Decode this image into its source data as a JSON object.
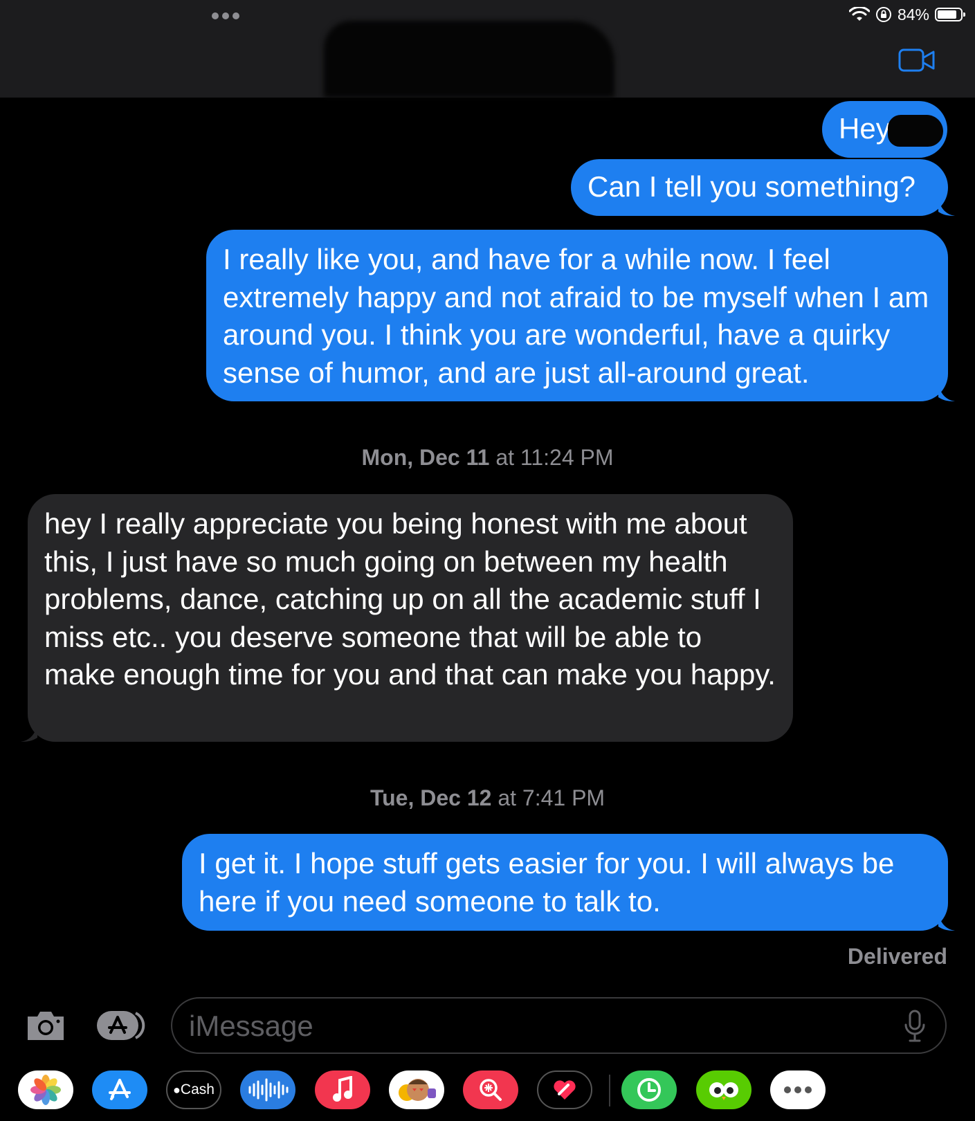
{
  "status_bar": {
    "battery_percent": "84%",
    "battery_level": 0.84
  },
  "messages": {
    "m1": "Hey",
    "m2": "Can I tell you something?",
    "m3": "I really like you, and have for a while now. I feel extremely happy and not afraid to be myself when I am around you. I think you are wonderful, have a quirky sense of humor, and are just all-around great.",
    "ts1_day": "Mon, Dec 11",
    "ts1_time": " at 11:24 PM",
    "m4": "hey I really appreciate you being honest with me about this, I just have so much going on between my health problems, dance, catching up on all the academic stuff I miss etc.. you deserve someone that will be able to make enough time for you and that can make you happy.",
    "ts2_day": "Tue, Dec 12",
    "ts2_time": " at 7:41 PM",
    "m5": "I get it. I hope stuff gets easier for you. I will always be here if you need someone to talk to.",
    "delivered": "Delivered"
  },
  "compose": {
    "placeholder": "iMessage"
  },
  "app_tray": [
    {
      "name": "photos-app-icon"
    },
    {
      "name": "app-store-app-icon"
    },
    {
      "name": "apple-cash-app-icon",
      "label": "Cash"
    },
    {
      "name": "audio-message-app-icon"
    },
    {
      "name": "music-app-icon"
    },
    {
      "name": "memoji-app-icon"
    },
    {
      "name": "images-search-app-icon"
    },
    {
      "name": "digital-touch-app-icon"
    },
    {
      "name": "clock-app-icon"
    },
    {
      "name": "duolingo-app-icon"
    },
    {
      "name": "more-apps-icon"
    }
  ],
  "colors": {
    "outgoing": "#1e7ff0",
    "incoming": "#262628",
    "background": "#000000",
    "accent": "#1e7ff0"
  }
}
